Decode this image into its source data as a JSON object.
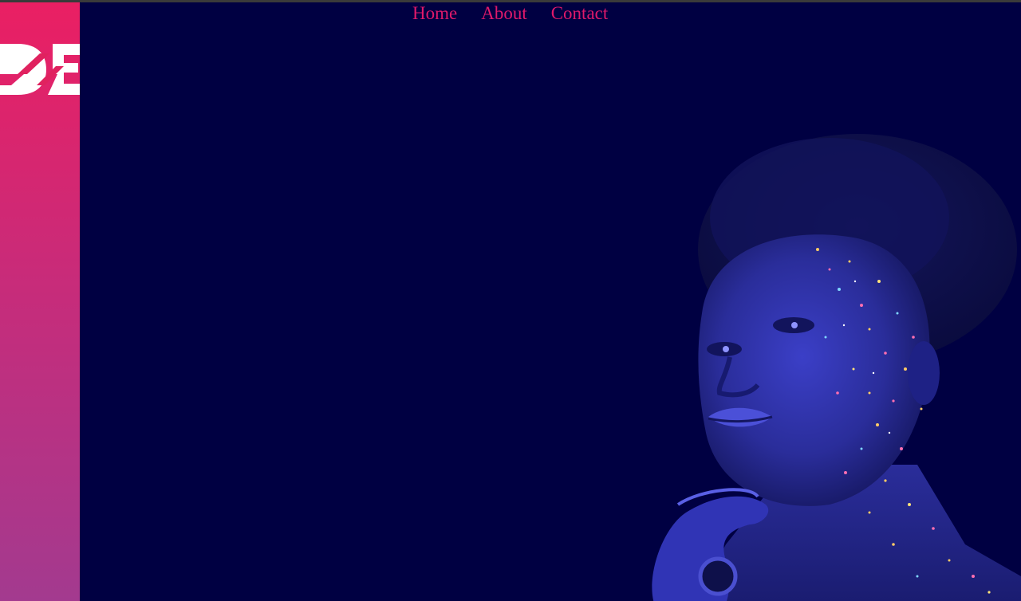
{
  "nav": {
    "items": [
      {
        "label": "Home"
      },
      {
        "label": "About"
      },
      {
        "label": "Contact"
      }
    ],
    "color": "#e0196a"
  },
  "logo": {
    "text": "DE",
    "color": "#ffffff"
  },
  "colors": {
    "background": "#000042",
    "sidebar_top": "#ea1f63",
    "sidebar_bottom": "#a33a8f"
  },
  "hero": {
    "image": "portrait-with-glitter-face-paint"
  }
}
